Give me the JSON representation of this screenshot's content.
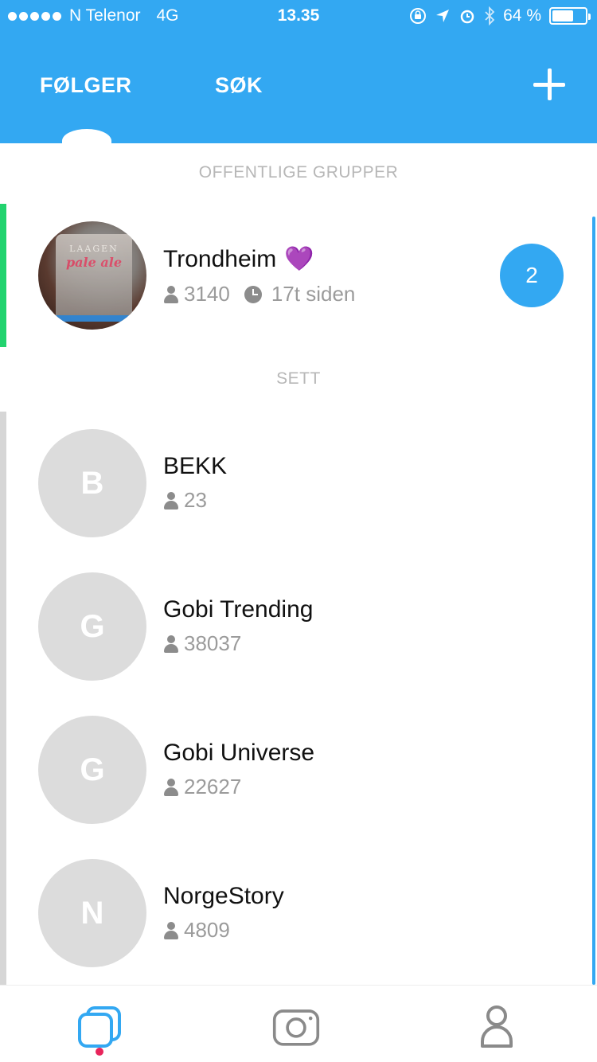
{
  "status_bar": {
    "carrier": "N Telenor",
    "network": "4G",
    "time": "13.35",
    "battery_percent": "64 %",
    "battery_level": 0.64
  },
  "header": {
    "tabs": [
      {
        "label": "FØLGER",
        "active": true
      },
      {
        "label": "SØK",
        "active": false
      }
    ],
    "add_icon": "plus-icon",
    "accent_color": "#33a8f2"
  },
  "sections": {
    "public_groups_label": "OFFENTLIGE GRUPPER",
    "seen_label": "SETT"
  },
  "public_groups": [
    {
      "name": "Trondheim",
      "emoji": "💜",
      "members": "3140",
      "time": "17t siden",
      "unread": "2",
      "bottle_brand": "LAAGEN",
      "bottle_label": "pale ale"
    }
  ],
  "seen_groups": [
    {
      "initial": "B",
      "name": "BEKK",
      "members": "23"
    },
    {
      "initial": "G",
      "name": "Gobi Trending",
      "members": "38037"
    },
    {
      "initial": "G",
      "name": "Gobi Universe",
      "members": "22627"
    },
    {
      "initial": "N",
      "name": "NorgeStory",
      "members": "4809"
    }
  ],
  "tab_bar": {
    "items": [
      "chats-icon",
      "camera-icon",
      "profile-icon"
    ],
    "active_index": 0,
    "active_dot_color": "#e8245b"
  }
}
